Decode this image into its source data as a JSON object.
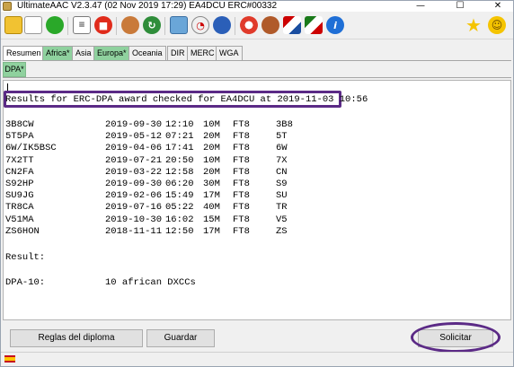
{
  "window": {
    "title": "UltimateAAC V2.3.47 (02 Nov 2019 17:29) EA4DCU ERC#00332",
    "minimize": "—",
    "maximize": "☐",
    "close": "✕"
  },
  "toolbar": {
    "icons": [
      "yellow-cube-icon",
      "empty-frame-icon",
      "green-circle-icon",
      "document-icon",
      "stop-icon",
      "contacts-icon",
      "sync-icon",
      "photo-icon",
      "gauge-icon",
      "globe-icon",
      "lifebuoy-icon",
      "user-settings-icon",
      "flags-icon",
      "compass-icon",
      "info-icon",
      "star-icon",
      "smiley-icon"
    ],
    "colors": {
      "green": "#2aa829",
      "red": "#e02b1b",
      "blue": "#1f6fd6",
      "yellow": "#f5c400"
    }
  },
  "tabs": [
    {
      "label": "Resumen",
      "active": false
    },
    {
      "label": "Africa*",
      "active": true
    },
    {
      "label": "Asia",
      "active": false
    },
    {
      "label": "Europa*",
      "active": true
    },
    {
      "label": "Oceania",
      "active": false
    },
    {
      "label": "DIR",
      "active": false
    },
    {
      "label": "MERC",
      "active": false
    },
    {
      "label": "WGA",
      "active": false
    }
  ],
  "subtab": {
    "label": "DPA*"
  },
  "report": {
    "header": "Results for ERC-DPA award checked for EA4DCU at 2019-11-03 10:56",
    "rows": [
      {
        "call": "3B8CW",
        "date": "2019-09-30",
        "time": "12:10",
        "band": "10M",
        "mode": "FT8",
        "dxcc": "3B8"
      },
      {
        "call": "5T5PA",
        "date": "2019-05-12",
        "time": "07:21",
        "band": "20M",
        "mode": "FT8",
        "dxcc": "5T"
      },
      {
        "call": "6W/IK5BSC",
        "date": "2019-04-06",
        "time": "17:41",
        "band": "20M",
        "mode": "FT8",
        "dxcc": "6W"
      },
      {
        "call": "7X2TT",
        "date": "2019-07-21",
        "time": "20:50",
        "band": "10M",
        "mode": "FT8",
        "dxcc": "7X"
      },
      {
        "call": "CN2FA",
        "date": "2019-03-22",
        "time": "12:58",
        "band": "20M",
        "mode": "FT8",
        "dxcc": "CN"
      },
      {
        "call": "S92HP",
        "date": "2019-09-30",
        "time": "06:20",
        "band": "30M",
        "mode": "FT8",
        "dxcc": "S9"
      },
      {
        "call": "SU9JG",
        "date": "2019-02-06",
        "time": "15:49",
        "band": "17M",
        "mode": "FT8",
        "dxcc": "SU"
      },
      {
        "call": "TR8CA",
        "date": "2019-07-16",
        "time": "05:22",
        "band": "40M",
        "mode": "FT8",
        "dxcc": "TR"
      },
      {
        "call": "V51MA",
        "date": "2019-10-30",
        "time": "16:02",
        "band": "15M",
        "mode": "FT8",
        "dxcc": "V5"
      },
      {
        "call": "ZS6HON",
        "date": "2018-11-11",
        "time": "12:50",
        "band": "17M",
        "mode": "FT8",
        "dxcc": "ZS"
      }
    ],
    "result_label": "Result:",
    "result_key": "DPA-10:",
    "result_value": "10 african DXCCs"
  },
  "buttons": {
    "rules": "Reglas del diploma",
    "save": "Guardar",
    "request": "Solicitar"
  },
  "statusbar": {
    "flag": "spain-flag-icon"
  }
}
